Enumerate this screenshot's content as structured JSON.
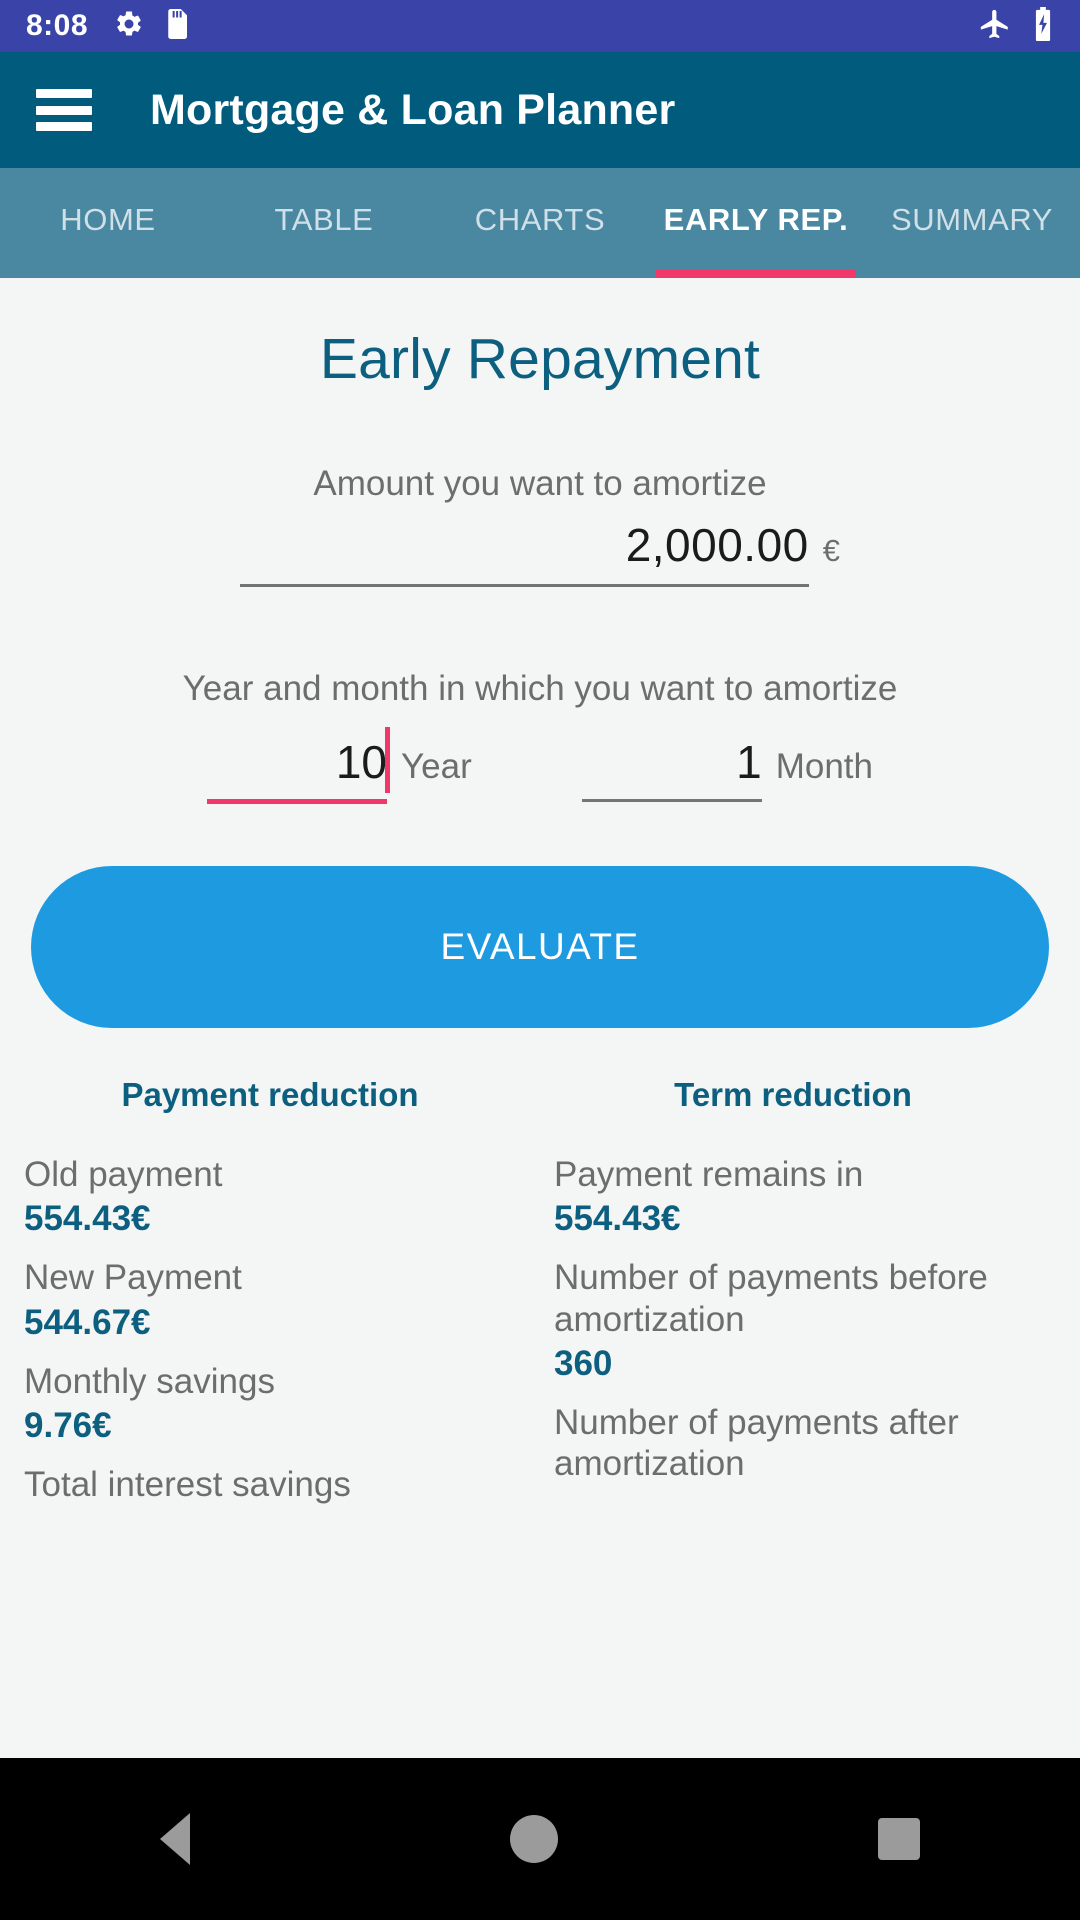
{
  "status_bar": {
    "time": "8:08",
    "left_icons": [
      "gear-icon",
      "sd-card-icon"
    ],
    "right_icons": [
      "airplane-mode-icon",
      "battery-charging-icon"
    ],
    "background": "#3a44a8"
  },
  "app_bar": {
    "menu_icon": "hamburger-menu-icon",
    "title": "Mortgage & Loan Planner",
    "background": "#005b7d"
  },
  "tabs": {
    "items": [
      {
        "label": "HOME",
        "active": false
      },
      {
        "label": "TABLE",
        "active": false
      },
      {
        "label": "CHARTS",
        "active": false
      },
      {
        "label": "EARLY REP.",
        "active": true
      },
      {
        "label": "SUMMARY",
        "active": false
      }
    ],
    "indicator_color": "#f0386b",
    "background": "#4a87a0"
  },
  "main": {
    "page_title": "Early Repayment",
    "amount": {
      "label": "Amount you want to amortize",
      "value": "2,000.00",
      "currency_suffix": "€"
    },
    "date": {
      "label": "Year and month in which you want to amortize",
      "year_value": "10",
      "year_unit": "Year",
      "month_value": "1",
      "month_unit": "Month",
      "focused_field": "year"
    },
    "evaluate_button": "EVALUATE",
    "payment_reduction": {
      "title": "Payment reduction",
      "rows": [
        {
          "label": "Old payment",
          "value": "554.43€"
        },
        {
          "label": "New Payment",
          "value": "544.67€"
        },
        {
          "label": "Monthly savings",
          "value": "9.76€"
        },
        {
          "label": "Total interest savings",
          "value": ""
        }
      ]
    },
    "term_reduction": {
      "title": "Term reduction",
      "rows": [
        {
          "label": "Payment remains in",
          "value": "554.43€"
        },
        {
          "label": "Number of payments before amortization",
          "value": "360"
        },
        {
          "label": "Number of payments after amortization",
          "value": ""
        }
      ]
    },
    "accent_color": "#0d5f80",
    "button_color": "#1e9ae0",
    "background": "#f4f5f5"
  },
  "nav_bar": {
    "items": [
      "back-icon",
      "home-icon",
      "recents-icon"
    ],
    "background": "#000000"
  }
}
